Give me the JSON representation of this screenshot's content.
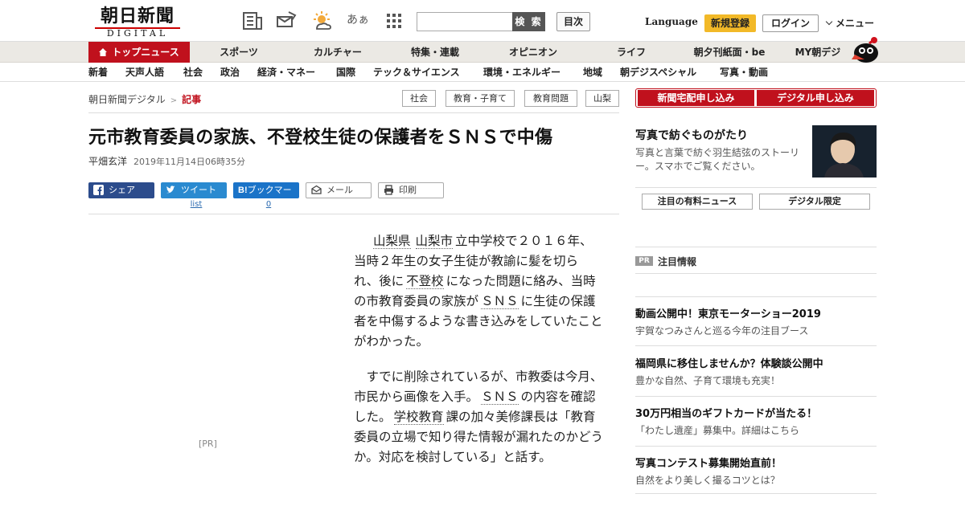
{
  "header": {
    "logo_main": "朝日新聞",
    "logo_sub": "DIGITAL",
    "icon_kana": "あぁ",
    "search_button": "検 索",
    "search_placeholder": "",
    "toc": "目次",
    "language": "Language",
    "register": "新規登録",
    "login": "ログイン",
    "menu": "メニュー"
  },
  "nav_primary": [
    "トップニュース",
    "スポーツ",
    "カルチャー",
    "特集・連載",
    "オピニオン",
    "ライフ",
    "朝夕刊紙面・be",
    "MY朝デジ"
  ],
  "nav_secondary": [
    "新着",
    "天声人語",
    "社会",
    "政治",
    "経済・マネー",
    "国際",
    "テック＆サイエンス",
    "環境・エネルギー",
    "地域",
    "朝デジスペシャル",
    "写真・動画"
  ],
  "breadcrumb": {
    "home": "朝日新聞デジタル",
    "sep": ">",
    "current": "記事"
  },
  "tags": [
    "社会",
    "教育・子育て",
    "教育問題",
    "山梨"
  ],
  "article": {
    "title": "元市教育委員の家族、不登校生徒の保護者をＳＮＳで中傷",
    "author": "平畑玄洋",
    "date": "2019年11月14日06時35分",
    "ad_label": "[PR]",
    "p1": {
      "kw1": "山梨県",
      "kw2": "山梨市",
      "t1": "立中学校で２０１６年、当時２年生の女子生徒が教諭に髪を切られ、後に",
      "kw3": "不登校",
      "t2": "になった問題に絡み、当時の市教育委員の家族が",
      "kw4": "ＳＮＳ",
      "t3": "に生徒の保護者を中傷するような書き込みをしていたことがわかった。"
    },
    "p2": {
      "t1": "すでに削除されているが、市教委は今月、市民から画像を入手。",
      "kw1": "ＳＮＳ",
      "t2": "の内容を確認した。",
      "kw2": "学校教育",
      "t3": "課の加々美修課長は「教育委員の立場で知り得た情報が漏れたのかどうか。対応を検討している」と話す。"
    }
  },
  "share": {
    "facebook": "シェア",
    "twitter": "ツイート",
    "hatena": "ブックマーク",
    "mail": "メール",
    "print": "印刷",
    "twitter_count": "list",
    "hatena_count": "0"
  },
  "sidebar": {
    "subscribe_paper": "新聞宅配申し込み",
    "subscribe_digital": "デジタル申し込み",
    "photo_story_title": "写真で紡ぐものがたり",
    "photo_story_desc": "写真と言葉で紡ぐ羽生結弦のストーリー。スマホでご覧ください。",
    "tab_paid": "注目の有料ニュース",
    "tab_digital": "デジタル限定",
    "pr_badge": "PR",
    "pr_heading": "注目情報",
    "pr_items": [
      {
        "title": "動画公開中！東京モーターショー2019",
        "desc": "宇賀なつみさんと巡る今年の注目ブース"
      },
      {
        "title": "福岡県に移住しませんか？体験談公開中",
        "desc": "豊かな自然、子育て環境も充実！"
      },
      {
        "title": "30万円相当のギフトカードが当たる！",
        "desc": "「わたし遺産」募集中。詳細はこちら"
      },
      {
        "title": "写真コンテスト募集開始直前！",
        "desc": "自然をより美しく撮るコツとは？"
      }
    ]
  }
}
